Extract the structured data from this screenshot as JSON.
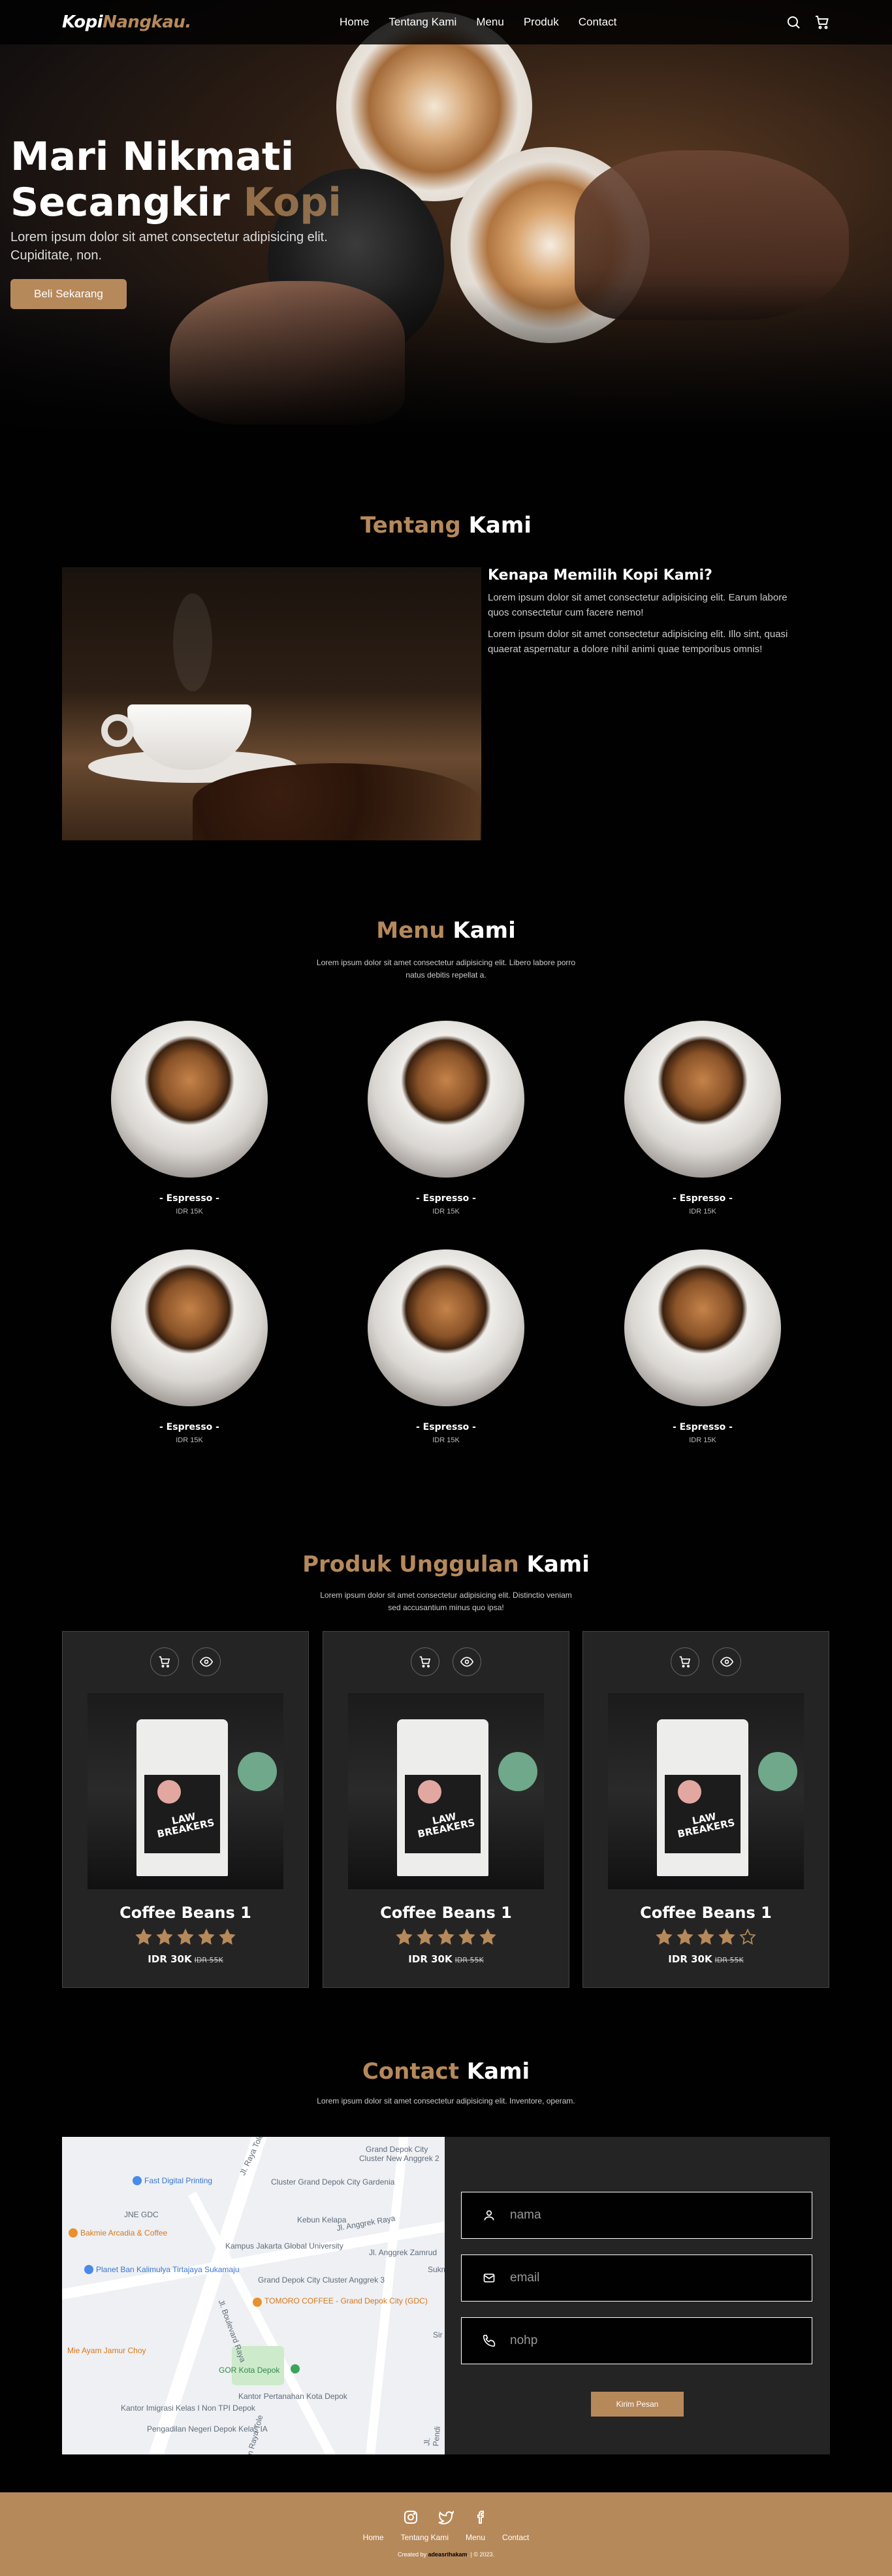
{
  "navbar": {
    "logo_main": "Kopi",
    "logo_accent": "Nangkau.",
    "links": [
      "Home",
      "Tentang Kami",
      "Menu",
      "Produk",
      "Contact"
    ],
    "icons": [
      "search-icon",
      "cart-icon"
    ]
  },
  "hero": {
    "title_line1": "Mari Nikmati",
    "title_line2_main": "Secangkir ",
    "title_line2_accent": "Kopi",
    "subtitle": "Lorem ipsum dolor sit amet consectetur adipisicing elit. Cupiditate, non.",
    "button": "Beli Sekarang"
  },
  "about": {
    "title_accent": "Tentang",
    "title_main": " Kami",
    "heading": "Kenapa Memilih Kopi Kami?",
    "p1": "Lorem ipsum dolor sit amet consectetur adipisicing elit. Earum labore quos consectetur cum facere nemo!",
    "p2": "Lorem ipsum dolor sit amet consectetur adipisicing elit. Illo sint, quasi quaerat aspernatur a dolore nihil animi quae temporibus omnis!"
  },
  "menu": {
    "title_accent": "Menu",
    "title_main": " Kami",
    "desc": "Lorem ipsum dolor sit amet consectetur adipisicing elit. Libero labore porro natus debitis repellat a.",
    "items": [
      {
        "name": "- Espresso -",
        "price": "IDR 15K"
      },
      {
        "name": "- Espresso -",
        "price": "IDR 15K"
      },
      {
        "name": "- Espresso -",
        "price": "IDR 15K"
      },
      {
        "name": "- Espresso -",
        "price": "IDR 15K"
      },
      {
        "name": "- Espresso -",
        "price": "IDR 15K"
      },
      {
        "name": "- Espresso -",
        "price": "IDR 15K"
      }
    ]
  },
  "products": {
    "title_accent": "Produk Unggulan",
    "title_main": " Kami",
    "desc": "Lorem ipsum dolor sit amet consectetur adipisicing elit. Distinctio veniam sed accusantium minus quo ipsa!",
    "items": [
      {
        "name": "Coffee Beans 1",
        "price": "IDR 30K",
        "old_price": "IDR 55K",
        "rating": 5,
        "bag_text": "LAW BREAKERS"
      },
      {
        "name": "Coffee Beans 1",
        "price": "IDR 30K",
        "old_price": "IDR 55K",
        "rating": 5,
        "bag_text": "LAW BREAKERS"
      },
      {
        "name": "Coffee Beans 1",
        "price": "IDR 30K",
        "old_price": "IDR 55K",
        "rating": 4,
        "bag_text": "LAW BREAKERS"
      }
    ]
  },
  "contact": {
    "title_accent": "Contact",
    "title_main": " Kami",
    "desc": "Lorem ipsum dolor sit amet consectetur adipisicing elit. Inventore, operam.",
    "placeholders": {
      "name": "nama",
      "email": "email",
      "phone": "nohp"
    },
    "button": "Kirim Pesan",
    "map_labels": [
      "Grand Depok City",
      "Cluster New Anggrek 2",
      "Fast Digital Printing",
      "Cluster Grand Depok City Gardenia",
      "JNE GDC",
      "Bakmie Arcadia & Coffee",
      "Kampus Jakarta Global University",
      "Planet Ban Kalimulya Tirtajaya Sukamaju",
      "Grand Depok City Cluster Anggrek 3",
      "TOMORO COFFEE - Grand Depok City (GDC)",
      "Mie Ayam Jamur Choy",
      "GOR Kota Depok",
      "Kantor Imigrasi Kelas I Non TPI Depok",
      "Kantor Pertanahan Kota Depok",
      "Pengadilan Negeri Depok Kelas IA",
      "Sukm",
      "Jl. Raya Tole",
      "Jl. Anggrek Raya",
      "Jl. Anggrek Zamrud",
      "Jl. Boulevard Raya",
      "Jl. Pendi",
      "Jalan Raya Tole",
      "Kebun Kelapa",
      "Sir"
    ]
  },
  "footer": {
    "social_icons": [
      "instagram-icon",
      "twitter-icon",
      "facebook-icon"
    ],
    "links": [
      "Home",
      "Tentang Kami",
      "Menu",
      "Contact"
    ],
    "credit_prefix": "Created by ",
    "credit_author": "adeasrihakam",
    "credit_suffix": ". | © 2023."
  },
  "colors": {
    "accent": "#b6895b",
    "background": "#010101",
    "card": "#242424"
  }
}
